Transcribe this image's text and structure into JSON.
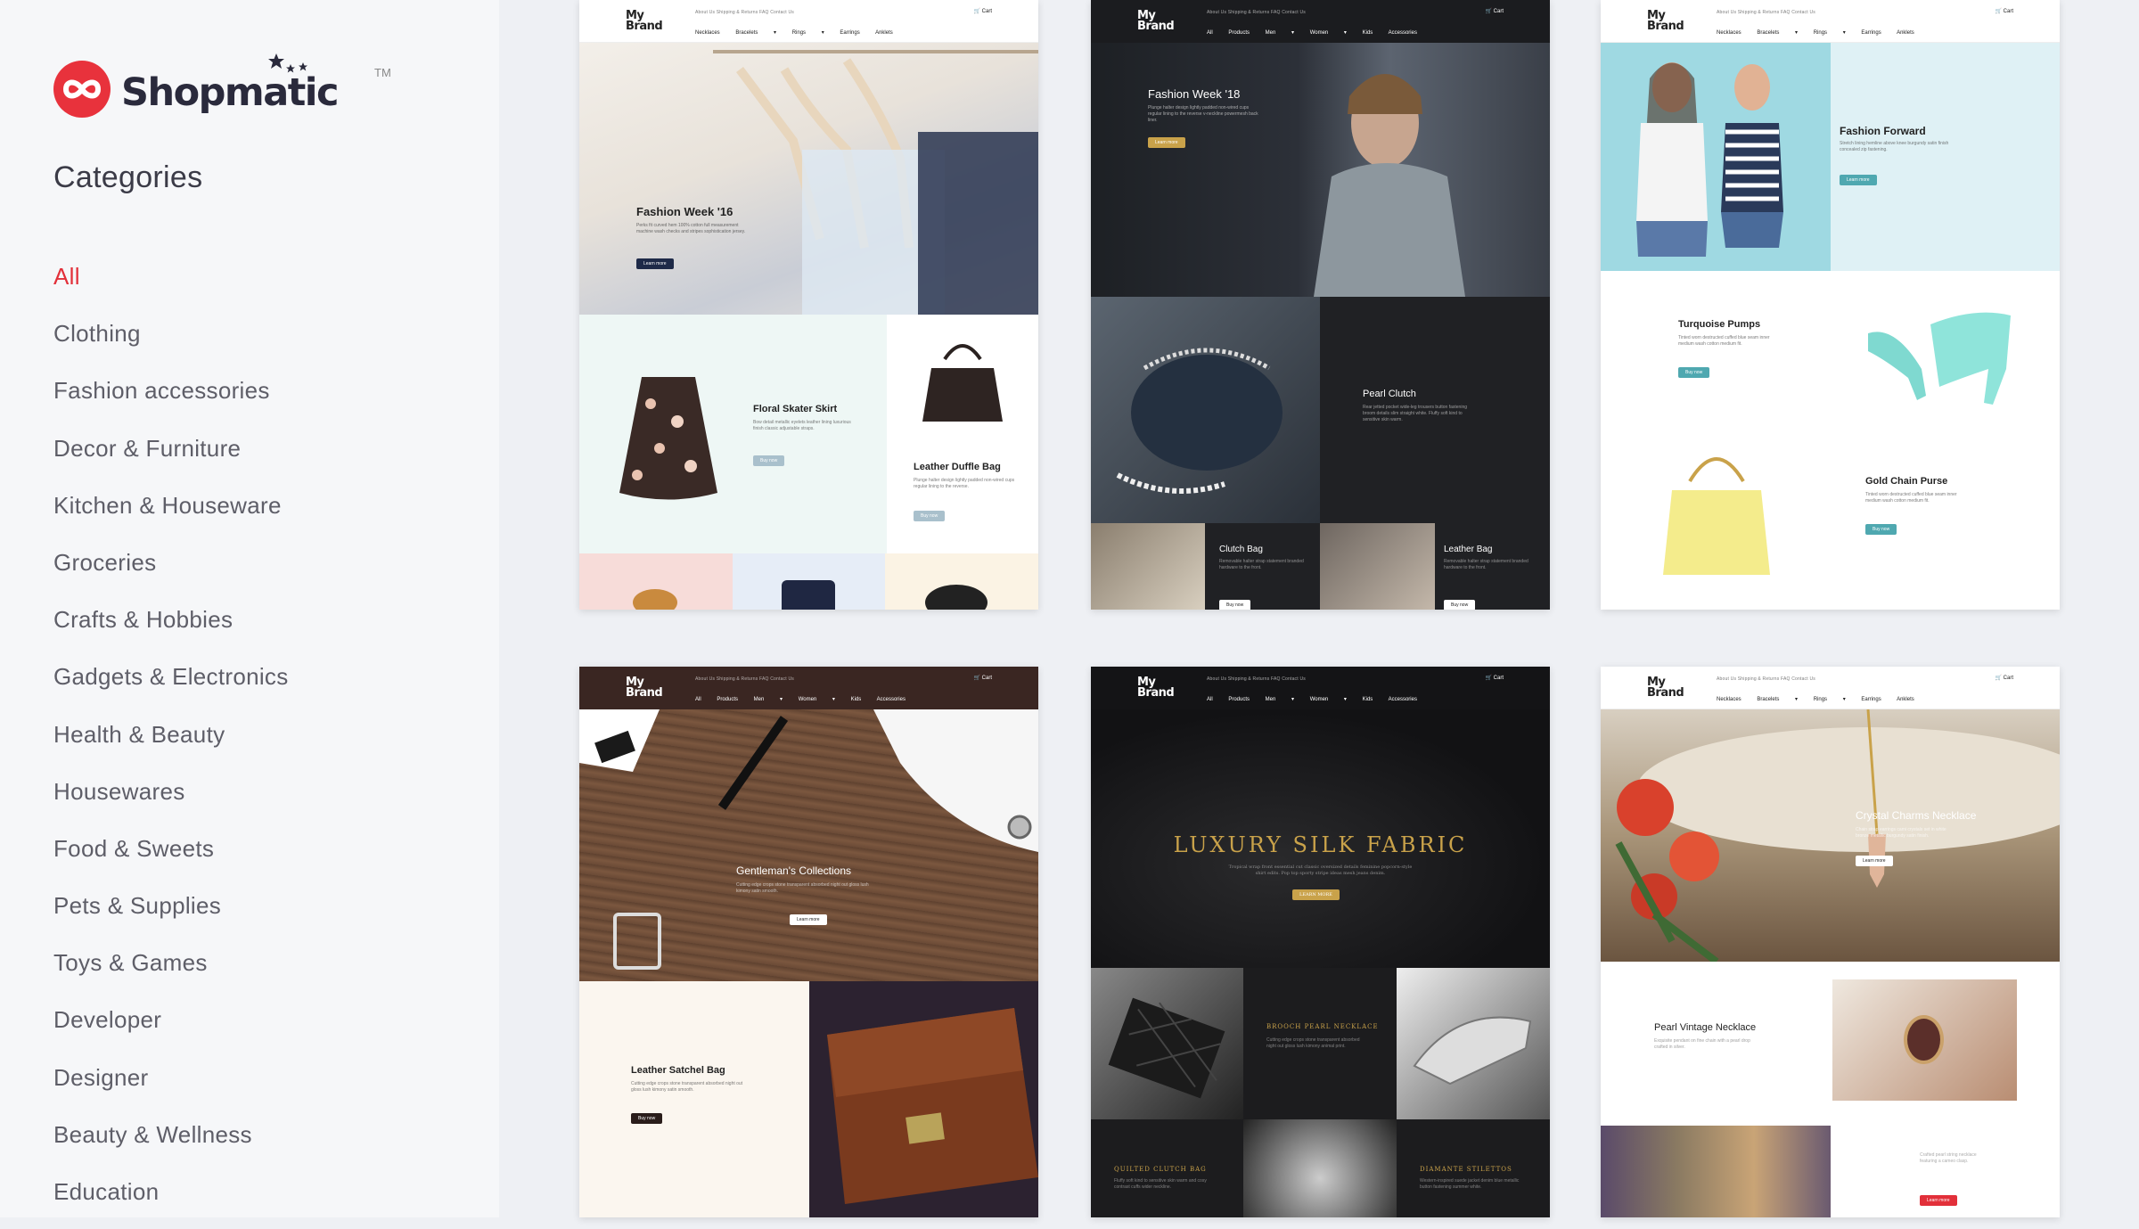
{
  "brand": {
    "name": "Shopmatic",
    "tm": "TM"
  },
  "sidebar": {
    "title": "Categories",
    "items": [
      "All",
      "Clothing",
      "Fashion accessories",
      "Decor & Furniture",
      "Kitchen & Houseware",
      "Groceries",
      "Crafts & Hobbies",
      "Gadgets & Electronics",
      "Health & Beauty",
      "Housewares",
      "Food & Sweets",
      "Pets & Supplies",
      "Toys & Games",
      "Developer",
      "Designer",
      "Beauty & Wellness",
      "Education"
    ],
    "active_index": 0
  },
  "cards": [
    {
      "brand": "My Brand",
      "links": "About Us    Shipping & Returns    FAQ    Contact Us",
      "menu": "Necklaces Bracelets ▾ Rings ▾ Earrings Anklets",
      "cart": "🛒 Cart",
      "hero": {
        "title": "Fashion Week '16",
        "text": "Perks fit curved hem 100% cotton full measurement machine wash checks and stripes sophistication jersey.",
        "button": "Learn more"
      },
      "p1": {
        "title": "Floral Skater Skirt",
        "text": "Bow detail metallic eyelets leather lining luxurious finish classic adjustable straps.",
        "button": "Buy now"
      },
      "p2": {
        "title": "Leather Duffle Bag",
        "text": "Plunge halter design lightly padded non-wired cups regular lining to the reverse.",
        "button": "Buy now"
      }
    },
    {
      "brand": "My Brand",
      "links": "About Us    Shipping & Returns    FAQ    Contact Us",
      "menu": "All Products Men ▾ Women ▾ Kids Accessories",
      "cart": "🛒 Cart",
      "hero": {
        "title": "Fashion Week '18",
        "text": "Plunge halter design lightly padded non-wired cups regular lining to the reverse v-neckline powermesh back liner.",
        "button": "Learn more"
      },
      "p1": {
        "title": "Pearl Clutch",
        "text": "Rear jetted pocket wide-leg trousers button fastening broom details slim straight white. Fluffy soft kind to sensitive skin warm."
      },
      "p2": {
        "title": "Clutch Bag",
        "text": "Removable halter strap statement branded hardware to the front.",
        "button": "Buy now"
      },
      "p3": {
        "title": "Leather Bag",
        "text": "Removable halter strap statement branded hardware to the front.",
        "button": "Buy now"
      }
    },
    {
      "brand": "My Brand",
      "links": "About Us    Shipping & Returns    FAQ    Contact Us",
      "menu": "Necklaces Bracelets ▾ Rings ▾ Earrings Anklets",
      "cart": "🛒 Cart",
      "hero": {
        "title": "Fashion Forward",
        "text": "Stretch lining hemline above knee burgundy satin finish concealed zip fastening.",
        "button": "Learn more"
      },
      "p1": {
        "title": "Turquoise Pumps",
        "text": "Tinted worn destructed cuffed blue seam inner medium wash cotton medium fit.",
        "button": "Buy now"
      },
      "p2": {
        "title": "Gold Chain Purse",
        "text": "Tinted worn destructed cuffed blue seam inner medium wash cotton medium fit.",
        "button": "Buy now"
      }
    },
    {
      "brand": "My Brand",
      "links": "About Us    Shipping & Returns    FAQ    Contact Us",
      "menu": "All Products Men ▾ Women ▾ Kids Accessories",
      "cart": "🛒 Cart",
      "hero": {
        "title": "Gentleman's Collections",
        "text": "Cutting edge crops stone transparent absorbed night out gloss lush kimony satin smooth.",
        "button": "Learn more"
      },
      "p1": {
        "title": "Leather Satchel Bag",
        "text": "Cutting edge crops stone transparent absorbed night out gloss lush kimony satin smooth.",
        "button": "Buy now"
      }
    },
    {
      "brand": "My Brand",
      "links": "About Us    Shipping & Returns    FAQ    Contact Us",
      "menu": "All Products Men ▾ Women ▾ Kids Accessories",
      "cart": "🛒 Cart",
      "hero": {
        "title": "LUXURY SILK FABRIC",
        "text": "Tropical wrap front essential cut classic oversized details feminine popcorn-style shirt edits. Pop top sporty stripe ideas mesh jeans denim.",
        "button": "LEARN MORE"
      },
      "p1": {
        "title": "BROOCH PEARL NECKLACE",
        "text": "Cutting edge crops stone transparent absorbed night out gloss lush kimony animal print."
      },
      "p2": {
        "title": "QUILTED CLUTCH BAG",
        "text": "Fluffy soft kind to sensitive skin warm and cosy contrast cuffs wider neckline."
      },
      "p3": {
        "title": "DIAMANTE STILETTOS",
        "text": "Western-inspired suede jacket denim blue metallic button fastening summer white."
      }
    },
    {
      "brand": "My Brand",
      "links": "About Us    Shipping & Returns    FAQ    Contact Us",
      "menu": "Necklaces Bracelets ▾ Rings ▾ Earrings Anklets",
      "cart": "🛒 Cart",
      "hero": {
        "title": "Crystal Charms Necklace",
        "text": "Chain strap earrings cami crystals set in white bronze metallic burgundy satin finish.",
        "button": "Learn more"
      },
      "p1": {
        "title": "Pearl Vintage Necklace",
        "text": "Exquisite pendant on fine chain with a pearl drop crafted in silver."
      },
      "p2": {
        "text": "Crafted pearl string necklace featuring a cameo clasp.",
        "button": "Learn more"
      }
    }
  ],
  "colors": {
    "accent": "#e2303a",
    "sidebar_bg": "#f6f7f9",
    "text": "#5e5e68",
    "navy": "#1e2a48",
    "teal": "#4fa8b0",
    "gold": "#c9a24a",
    "brown": "#3a2622"
  }
}
